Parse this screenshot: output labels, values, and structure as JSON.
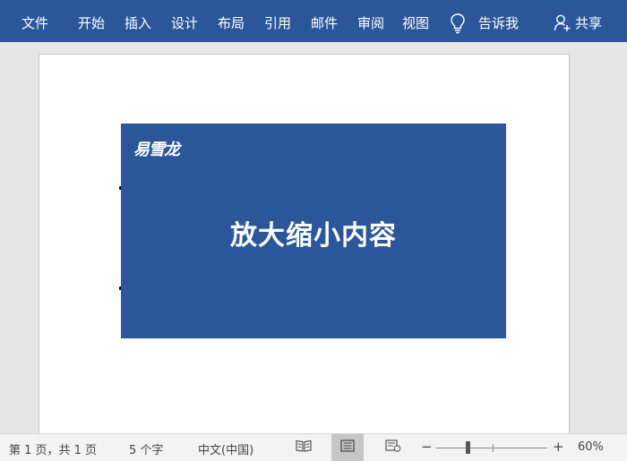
{
  "ribbon": {
    "tabs": [
      "文件",
      "开始",
      "插入",
      "设计",
      "布局",
      "引用",
      "邮件",
      "审阅",
      "视图"
    ],
    "tell_me": "告诉我",
    "share": "共享"
  },
  "document": {
    "logo_text": "易雪龙",
    "headline": "放大缩小内容"
  },
  "statusbar": {
    "page_info": "第 1 页，共 1 页",
    "word_count": "5 个字",
    "language": "中文(中国)",
    "zoom_minus": "−",
    "zoom_plus": "+",
    "zoom_percent": "60%",
    "zoom_value": 60,
    "active_view": "print-layout"
  },
  "colors": {
    "ribbon": "#2b579a",
    "banner": "#2b579a",
    "canvas": "#e6e6e6"
  }
}
